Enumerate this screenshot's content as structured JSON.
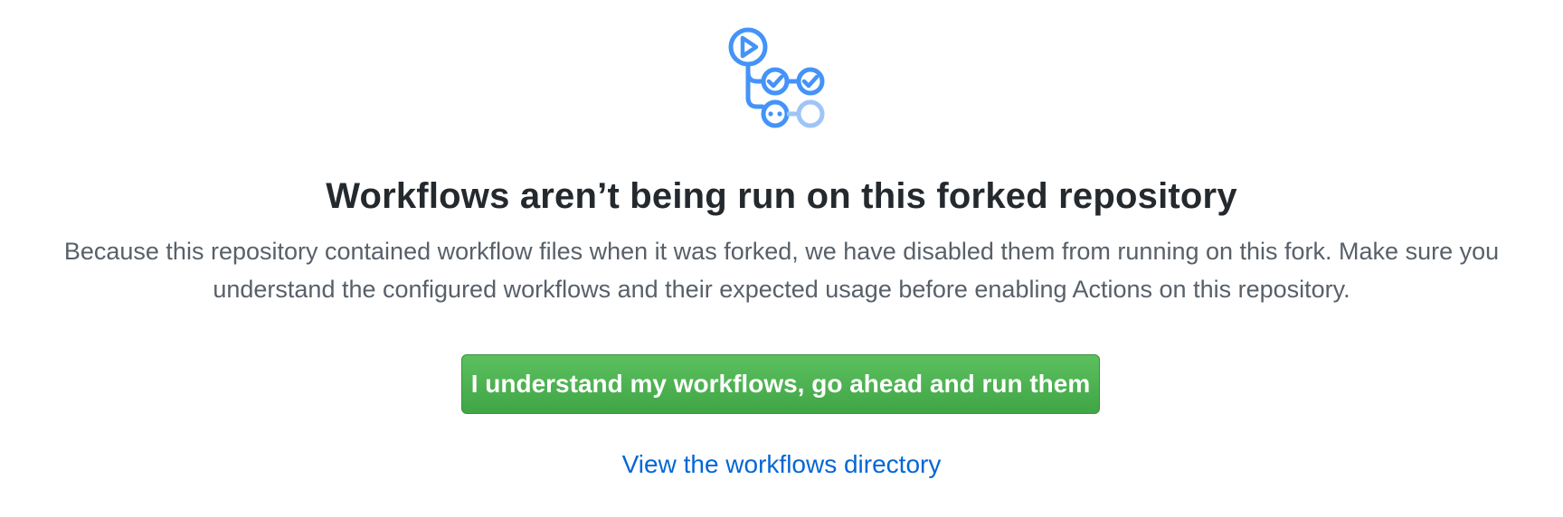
{
  "empty_state": {
    "icon": "actions-workflow-icon",
    "title": "Workflows aren’t being run on this forked repository",
    "description": "Because this repository contained workflow files when it was forked, we have disabled them from running on this fork. Make sure you understand the configured workflows and their expected usage before enabling Actions on this repository.",
    "enable_button_label": "I understand my workflows, go ahead and run them",
    "workflows_link_label": "View the workflows directory"
  },
  "colors": {
    "icon_primary": "#4493f8",
    "icon_light": "#9ec5f8",
    "title": "#24292e",
    "text": "#586069",
    "button": "#4cb050",
    "link": "#0366d6"
  }
}
